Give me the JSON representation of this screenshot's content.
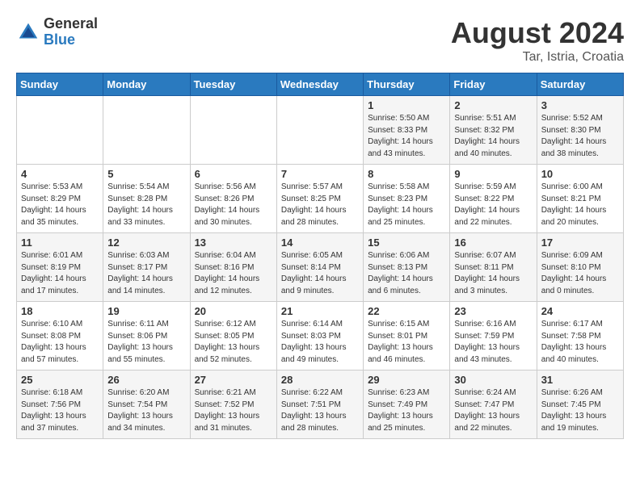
{
  "logo": {
    "general": "General",
    "blue": "Blue"
  },
  "title": "August 2024",
  "location": "Tar, Istria, Croatia",
  "days_of_week": [
    "Sunday",
    "Monday",
    "Tuesday",
    "Wednesday",
    "Thursday",
    "Friday",
    "Saturday"
  ],
  "weeks": [
    [
      {
        "num": "",
        "info": ""
      },
      {
        "num": "",
        "info": ""
      },
      {
        "num": "",
        "info": ""
      },
      {
        "num": "",
        "info": ""
      },
      {
        "num": "1",
        "info": "Sunrise: 5:50 AM\nSunset: 8:33 PM\nDaylight: 14 hours and 43 minutes."
      },
      {
        "num": "2",
        "info": "Sunrise: 5:51 AM\nSunset: 8:32 PM\nDaylight: 14 hours and 40 minutes."
      },
      {
        "num": "3",
        "info": "Sunrise: 5:52 AM\nSunset: 8:30 PM\nDaylight: 14 hours and 38 minutes."
      }
    ],
    [
      {
        "num": "4",
        "info": "Sunrise: 5:53 AM\nSunset: 8:29 PM\nDaylight: 14 hours and 35 minutes."
      },
      {
        "num": "5",
        "info": "Sunrise: 5:54 AM\nSunset: 8:28 PM\nDaylight: 14 hours and 33 minutes."
      },
      {
        "num": "6",
        "info": "Sunrise: 5:56 AM\nSunset: 8:26 PM\nDaylight: 14 hours and 30 minutes."
      },
      {
        "num": "7",
        "info": "Sunrise: 5:57 AM\nSunset: 8:25 PM\nDaylight: 14 hours and 28 minutes."
      },
      {
        "num": "8",
        "info": "Sunrise: 5:58 AM\nSunset: 8:23 PM\nDaylight: 14 hours and 25 minutes."
      },
      {
        "num": "9",
        "info": "Sunrise: 5:59 AM\nSunset: 8:22 PM\nDaylight: 14 hours and 22 minutes."
      },
      {
        "num": "10",
        "info": "Sunrise: 6:00 AM\nSunset: 8:21 PM\nDaylight: 14 hours and 20 minutes."
      }
    ],
    [
      {
        "num": "11",
        "info": "Sunrise: 6:01 AM\nSunset: 8:19 PM\nDaylight: 14 hours and 17 minutes."
      },
      {
        "num": "12",
        "info": "Sunrise: 6:03 AM\nSunset: 8:17 PM\nDaylight: 14 hours and 14 minutes."
      },
      {
        "num": "13",
        "info": "Sunrise: 6:04 AM\nSunset: 8:16 PM\nDaylight: 14 hours and 12 minutes."
      },
      {
        "num": "14",
        "info": "Sunrise: 6:05 AM\nSunset: 8:14 PM\nDaylight: 14 hours and 9 minutes."
      },
      {
        "num": "15",
        "info": "Sunrise: 6:06 AM\nSunset: 8:13 PM\nDaylight: 14 hours and 6 minutes."
      },
      {
        "num": "16",
        "info": "Sunrise: 6:07 AM\nSunset: 8:11 PM\nDaylight: 14 hours and 3 minutes."
      },
      {
        "num": "17",
        "info": "Sunrise: 6:09 AM\nSunset: 8:10 PM\nDaylight: 14 hours and 0 minutes."
      }
    ],
    [
      {
        "num": "18",
        "info": "Sunrise: 6:10 AM\nSunset: 8:08 PM\nDaylight: 13 hours and 57 minutes."
      },
      {
        "num": "19",
        "info": "Sunrise: 6:11 AM\nSunset: 8:06 PM\nDaylight: 13 hours and 55 minutes."
      },
      {
        "num": "20",
        "info": "Sunrise: 6:12 AM\nSunset: 8:05 PM\nDaylight: 13 hours and 52 minutes."
      },
      {
        "num": "21",
        "info": "Sunrise: 6:14 AM\nSunset: 8:03 PM\nDaylight: 13 hours and 49 minutes."
      },
      {
        "num": "22",
        "info": "Sunrise: 6:15 AM\nSunset: 8:01 PM\nDaylight: 13 hours and 46 minutes."
      },
      {
        "num": "23",
        "info": "Sunrise: 6:16 AM\nSunset: 7:59 PM\nDaylight: 13 hours and 43 minutes."
      },
      {
        "num": "24",
        "info": "Sunrise: 6:17 AM\nSunset: 7:58 PM\nDaylight: 13 hours and 40 minutes."
      }
    ],
    [
      {
        "num": "25",
        "info": "Sunrise: 6:18 AM\nSunset: 7:56 PM\nDaylight: 13 hours and 37 minutes."
      },
      {
        "num": "26",
        "info": "Sunrise: 6:20 AM\nSunset: 7:54 PM\nDaylight: 13 hours and 34 minutes."
      },
      {
        "num": "27",
        "info": "Sunrise: 6:21 AM\nSunset: 7:52 PM\nDaylight: 13 hours and 31 minutes."
      },
      {
        "num": "28",
        "info": "Sunrise: 6:22 AM\nSunset: 7:51 PM\nDaylight: 13 hours and 28 minutes."
      },
      {
        "num": "29",
        "info": "Sunrise: 6:23 AM\nSunset: 7:49 PM\nDaylight: 13 hours and 25 minutes."
      },
      {
        "num": "30",
        "info": "Sunrise: 6:24 AM\nSunset: 7:47 PM\nDaylight: 13 hours and 22 minutes."
      },
      {
        "num": "31",
        "info": "Sunrise: 6:26 AM\nSunset: 7:45 PM\nDaylight: 13 hours and 19 minutes."
      }
    ]
  ]
}
